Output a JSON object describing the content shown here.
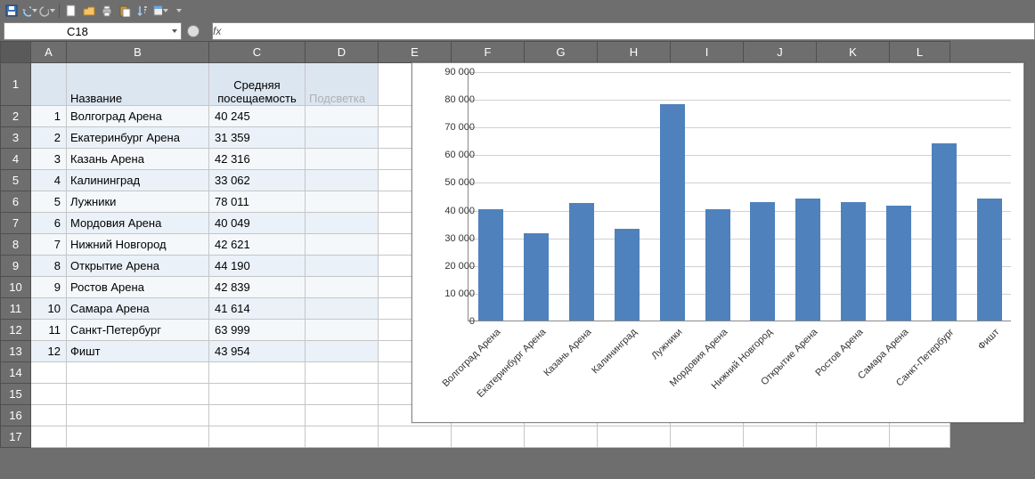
{
  "namebox": {
    "ref": "C18"
  },
  "formula_bar": {
    "fx_label": "fx",
    "value": ""
  },
  "columns": [
    "A",
    "B",
    "C",
    "D",
    "E",
    "F",
    "G",
    "H",
    "I",
    "J",
    "K",
    "L"
  ],
  "row_headers": [
    "1",
    "2",
    "3",
    "4",
    "5",
    "6",
    "7",
    "8",
    "9",
    "10",
    "11",
    "12",
    "13",
    "14",
    "15",
    "16",
    "17"
  ],
  "table": {
    "header": {
      "A": "",
      "B": "Название",
      "C": "Средняя посещаемость",
      "D": "Подсветка"
    },
    "rows": [
      {
        "n": "1",
        "name": "Волгоград Арена",
        "avg": "40 245"
      },
      {
        "n": "2",
        "name": "Екатеринбург Арена",
        "avg": "31 359"
      },
      {
        "n": "3",
        "name": "Казань Арена",
        "avg": "42 316"
      },
      {
        "n": "4",
        "name": "Калининград",
        "avg": "33 062"
      },
      {
        "n": "5",
        "name": "Лужники",
        "avg": "78 011"
      },
      {
        "n": "6",
        "name": "Мордовия Арена",
        "avg": "40 049"
      },
      {
        "n": "7",
        "name": "Нижний Новгород",
        "avg": "42 621"
      },
      {
        "n": "8",
        "name": "Открытие Арена",
        "avg": "44 190"
      },
      {
        "n": "9",
        "name": "Ростов Арена",
        "avg": "42 839"
      },
      {
        "n": "10",
        "name": "Самара Арена",
        "avg": "41 614"
      },
      {
        "n": "11",
        "name": "Санкт-Петербург",
        "avg": "63 999"
      },
      {
        "n": "12",
        "name": "Фишт",
        "avg": "43 954"
      }
    ]
  },
  "chart_data": {
    "type": "bar",
    "title": "",
    "xlabel": "",
    "ylabel": "",
    "ylim": [
      0,
      90000
    ],
    "ytick_step": 10000,
    "yticks_fmt": [
      "0",
      "10 000",
      "20 000",
      "30 000",
      "40 000",
      "50 000",
      "60 000",
      "70 000",
      "80 000",
      "90 000"
    ],
    "categories": [
      "Волгоград Арена",
      "Екатеринбург Арена",
      "Казань Арена",
      "Калининград",
      "Лужники",
      "Мордовия Арена",
      "Нижний Новгород",
      "Открытие Арена",
      "Ростов Арена",
      "Самара Арена",
      "Санкт-Петербург",
      "Фишт"
    ],
    "values": [
      40245,
      31359,
      42316,
      33062,
      78011,
      40049,
      42621,
      44190,
      42839,
      41614,
      63999,
      43954
    ],
    "bar_color": "#4f81bd"
  }
}
